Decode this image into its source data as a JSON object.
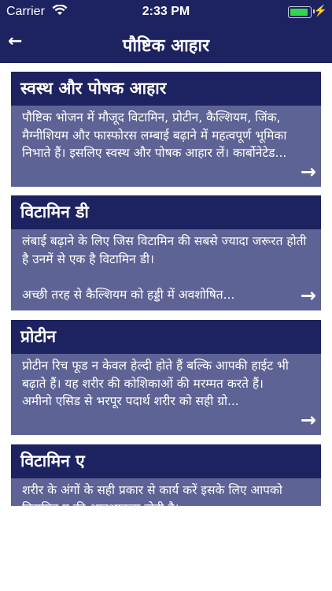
{
  "status_bar": {
    "carrier": "Carrier",
    "time": "2:33 PM",
    "wifi_icon": "wifi-icon",
    "battery_icon": "battery-icon"
  },
  "navbar": {
    "title": "पौष्टिक आहार",
    "back_icon": "back-arrow-icon"
  },
  "cards": [
    {
      "title": "स्वस्थ और पोषक आहार",
      "text": "पौष्टिक भोजन में मौजूद विटामिन, प्रोटीन, कैल्शियम, जिंक, मैग्नीशियम और फास्फोरस लम्बाई बढ़ाने में महत्वपूर्ण भूमिका निभाते हैं। इसलिए स्वस्थ और पोषक आहार लें। कार्बोनेटेड..."
    },
    {
      "title": "विटामिन डी",
      "text": "लंबाई बढ़ाने के लिए जिस विटामिन की सबसे ज्यादा जरूरत होती है उनमें से एक है विटामिन डी।\n\nअच्छी तरह से कैल्शियम को हड्डी में अवशोषित..."
    },
    {
      "title": "प्रोटीन",
      "text": "प्रोटीन रिच फूड न केवल हेल्दी होते हैं बल्कि आपकी हाईट भी बढ़ाते हैं। यह शरीर की कोशिकाओं की मरम्मत करते हैं।\nअमीनो एसिड से भरपूर पदार्थ शरीर को सही ग्रो..."
    },
    {
      "title": "विटामिन ए",
      "text": "शरीर के अंगों के सही प्रकार से कार्य करें इसके लिए आपको विटामिन ए की आवश्यकता होती है।"
    }
  ],
  "arrow_icon": "→"
}
